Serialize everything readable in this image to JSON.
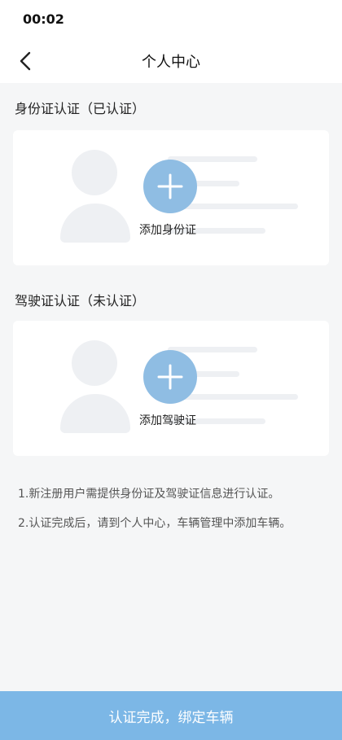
{
  "status_bar": {
    "time": "00:02"
  },
  "header": {
    "title": "个人中心",
    "back_icon": "chevron-left-icon"
  },
  "sections": [
    {
      "title": "身份证认证（已认证）",
      "action_label": "添加身份证",
      "status": "已认证"
    },
    {
      "title": "驾驶证认证（未认证）",
      "action_label": "添加驾驶证",
      "status": "未认证"
    }
  ],
  "notes": [
    "1.新注册用户需提供身份证及驾驶证信息进行认证。",
    "2.认证完成后，请到个人中心，车辆管理中添加车辆。"
  ],
  "footer": {
    "button_label": "认证完成，绑定车辆"
  },
  "colors": {
    "accent": "#7cb7e6",
    "plus_circle": "#8fbde3",
    "placeholder": "#eef0f3",
    "background": "#f5f6f7"
  }
}
